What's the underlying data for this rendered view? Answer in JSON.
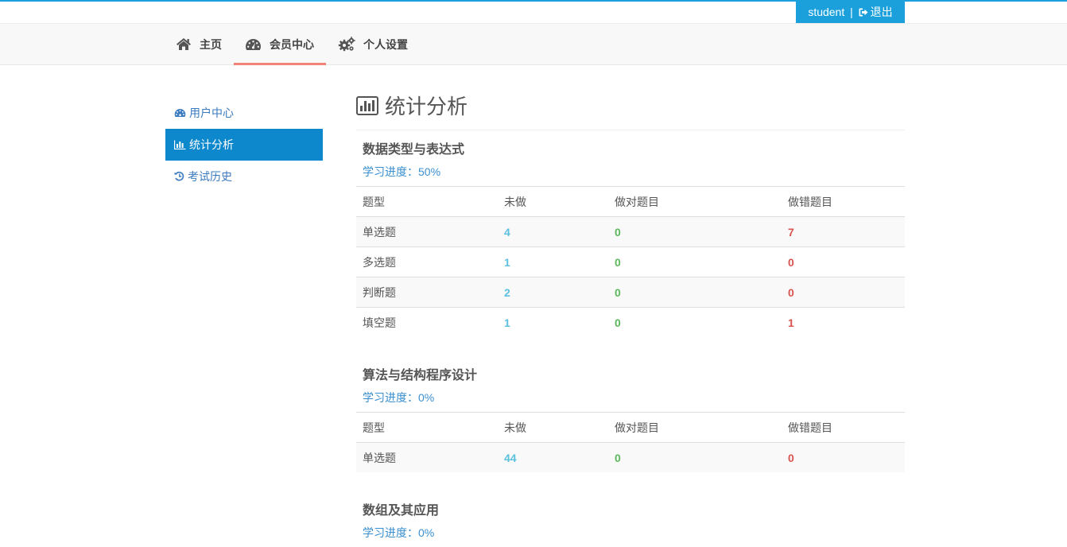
{
  "header": {
    "username": "student",
    "separator": "|",
    "logout_label": "退出"
  },
  "nav": [
    {
      "label": "主页",
      "icon": "home-icon"
    },
    {
      "label": "会员中心",
      "icon": "dashboard-icon",
      "active": true
    },
    {
      "label": "个人设置",
      "icon": "gears-icon"
    }
  ],
  "sidebar": [
    {
      "label": "用户中心",
      "icon": "dashboard-icon"
    },
    {
      "label": "统计分析",
      "icon": "bar-chart-icon",
      "active": true
    },
    {
      "label": "考试历史",
      "icon": "history-icon"
    }
  ],
  "page": {
    "title": "统计分析"
  },
  "table_headers": [
    "题型",
    "未做",
    "做对题目",
    "做错题目"
  ],
  "sections": [
    {
      "title": "数据类型与表达式",
      "progress": "学习进度：50%",
      "rows": [
        {
          "type": "单选题",
          "undone": "4",
          "correct": "0",
          "wrong": "7"
        },
        {
          "type": "多选题",
          "undone": "1",
          "correct": "0",
          "wrong": "0"
        },
        {
          "type": "判断题",
          "undone": "2",
          "correct": "0",
          "wrong": "0"
        },
        {
          "type": "填空题",
          "undone": "1",
          "correct": "0",
          "wrong": "1"
        }
      ]
    },
    {
      "title": "算法与结构程序设计",
      "progress": "学习进度：0%",
      "rows": [
        {
          "type": "单选题",
          "undone": "44",
          "correct": "0",
          "wrong": "0"
        }
      ]
    },
    {
      "title": "数组及其应用",
      "progress": "学习进度：0%",
      "rows": []
    }
  ],
  "colors": {
    "accent": "#1ba0dc",
    "sidebar_active": "#0e88cc",
    "nav_active_underline": "#f38377",
    "undone": "#5bc0de",
    "correct": "#5cb85c",
    "wrong": "#d9534f"
  }
}
